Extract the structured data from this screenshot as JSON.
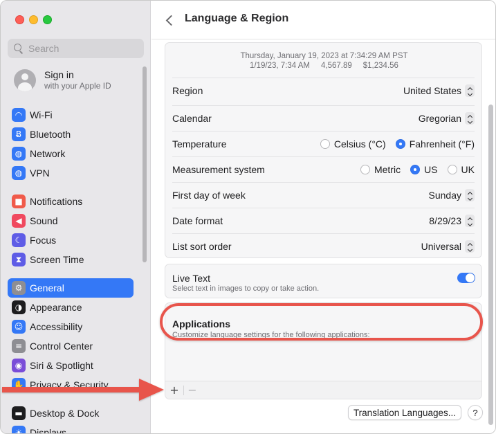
{
  "window": {
    "title": "Language & Region"
  },
  "search": {
    "placeholder": "Search"
  },
  "account": {
    "title": "Sign in",
    "subtitle": "with your Apple ID"
  },
  "sidebar": {
    "items": [
      {
        "label": "Wi-Fi",
        "icon": "wifi-icon",
        "color": "#3478f6",
        "glyph": "◠"
      },
      {
        "label": "Bluetooth",
        "icon": "bluetooth-icon",
        "color": "#3478f6",
        "glyph": "Ƀ"
      },
      {
        "label": "Network",
        "icon": "globe-icon",
        "color": "#3478f6",
        "glyph": "◍"
      },
      {
        "label": "VPN",
        "icon": "vpn-globe-icon",
        "color": "#3478f6",
        "glyph": "◍"
      },
      {
        "label": "Notifications",
        "icon": "bell-icon",
        "color": "#f05a4a",
        "glyph": "■"
      },
      {
        "label": "Sound",
        "icon": "speaker-icon",
        "color": "#f0495f",
        "glyph": "◀"
      },
      {
        "label": "Focus",
        "icon": "moon-icon",
        "color": "#5e5ce6",
        "glyph": "☾"
      },
      {
        "label": "Screen Time",
        "icon": "hourglass-icon",
        "color": "#5e5ce6",
        "glyph": "⧗"
      },
      {
        "label": "General",
        "icon": "gear-icon",
        "color": "#8e8e93",
        "glyph": "⚙",
        "selected": true
      },
      {
        "label": "Appearance",
        "icon": "appearance-icon",
        "color": "#1d1d1f",
        "glyph": "◑"
      },
      {
        "label": "Accessibility",
        "icon": "accessibility-icon",
        "color": "#3478f6",
        "glyph": "☺"
      },
      {
        "label": "Control Center",
        "icon": "control-center-icon",
        "color": "#8e8e93",
        "glyph": "≡"
      },
      {
        "label": "Siri & Spotlight",
        "icon": "siri-icon",
        "color": "#7a4dd8",
        "glyph": "◉"
      },
      {
        "label": "Privacy & Security",
        "icon": "hand-icon",
        "color": "#3478f6",
        "glyph": "✋"
      },
      {
        "label": "Desktop & Dock",
        "icon": "dock-icon",
        "color": "#1d1d1f",
        "glyph": "▬"
      },
      {
        "label": "Displays",
        "icon": "display-icon",
        "color": "#3478f6",
        "glyph": "☀"
      }
    ]
  },
  "preview": {
    "line1": "Thursday, January 19, 2023 at 7:34:29 AM PST",
    "short_date": "1/19/23, 7:34 AM",
    "number": "4,567.89",
    "currency": "$1,234.56"
  },
  "settings": {
    "region": {
      "label": "Region",
      "value": "United States"
    },
    "calendar": {
      "label": "Calendar",
      "value": "Gregorian"
    },
    "temperature": {
      "label": "Temperature",
      "option1": "Celsius (°C)",
      "option2": "Fahrenheit (°F)",
      "selected": "Fahrenheit (°F)"
    },
    "measurement": {
      "label": "Measurement system",
      "option1": "Metric",
      "option2": "US",
      "option3": "UK",
      "selected": "US"
    },
    "first_day": {
      "label": "First day of week",
      "value": "Sunday"
    },
    "date_format": {
      "label": "Date format",
      "value": "8/29/23"
    },
    "sort_order": {
      "label": "List sort order",
      "value": "Universal"
    }
  },
  "live_text": {
    "title": "Live Text",
    "subtitle": "Select text in images to copy or take action.",
    "enabled": true
  },
  "applications": {
    "title": "Applications",
    "subtitle": "Customize language settings for the following applications:",
    "add": "+",
    "remove": "−"
  },
  "buttons": {
    "translation": "Translation Languages...",
    "help": "?"
  },
  "colors": {
    "accent": "#3478f6",
    "annotation": "#e8554c"
  }
}
